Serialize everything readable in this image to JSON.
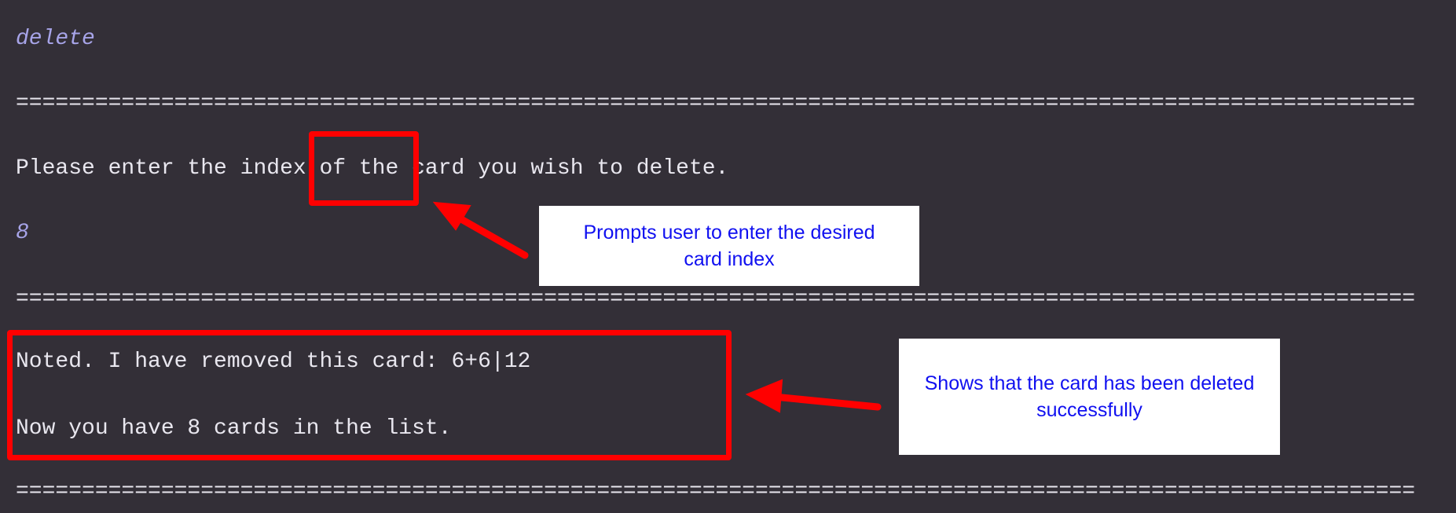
{
  "terminal": {
    "command_input": "delete",
    "separator": "==========================================================================================================",
    "prompt": {
      "before": "Please enter the ",
      "highlight": "index",
      "after": " of the card you wish to delete."
    },
    "index_input": "8",
    "result_line_1": "Noted. I have removed this card: 6+6|12",
    "result_line_2": "Now you have 8 cards in the list."
  },
  "annotations": {
    "callout_prompt": "Prompts user to enter the desired card index",
    "callout_result": "Shows that the card has been deleted successfully",
    "highlight_color": "#ff0000",
    "callout_text_color": "#1010f0"
  }
}
